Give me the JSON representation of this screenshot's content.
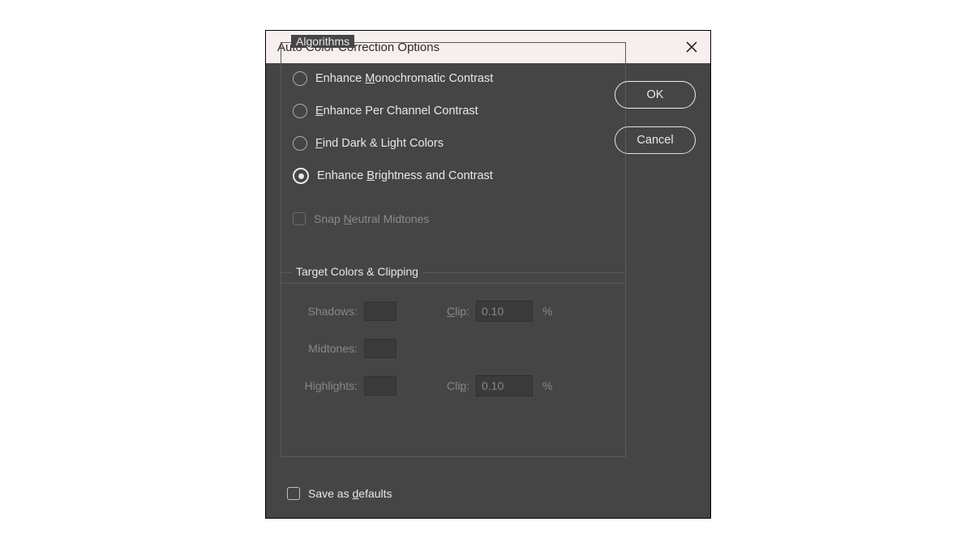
{
  "dialog": {
    "title": "Auto Color Correction Options",
    "close_icon": "close"
  },
  "algorithms": {
    "legend": "Algorithms",
    "options": [
      {
        "label_pre": "Enhance ",
        "mnemonic": "M",
        "label_post": "onochromatic Contrast",
        "selected": false
      },
      {
        "label_pre": "",
        "mnemonic": "E",
        "label_post": "nhance Per Channel Contrast",
        "selected": false
      },
      {
        "label_pre": "",
        "mnemonic": "F",
        "label_post": "ind Dark & Light Colors",
        "selected": false
      },
      {
        "label_pre": "Enhance ",
        "mnemonic": "B",
        "label_post": "rightness and Contrast",
        "selected": true
      }
    ],
    "snap": {
      "pre": "Snap ",
      "mnemonic": "N",
      "post": "eutral Midtones",
      "enabled": false,
      "checked": false
    }
  },
  "targets": {
    "legend": "Target Colors & Clipping",
    "rows": {
      "shadows": {
        "label": "Shadows:",
        "clip_label_pre": "",
        "clip_mnemonic": "C",
        "clip_label_post": "lip:",
        "clip_value": "0.10",
        "pct": "%"
      },
      "midtones": {
        "label": "Midtones:"
      },
      "highlights": {
        "label": "Highlights:",
        "clip_label_pre": "Cli",
        "clip_mnemonic": "p",
        "clip_label_post": ":",
        "clip_value": "0.10",
        "pct": "%"
      }
    },
    "enabled": false
  },
  "save_defaults": {
    "pre": "Save as ",
    "mnemonic": "d",
    "post": "efaults",
    "checked": false
  },
  "buttons": {
    "ok": "OK",
    "cancel": "Cancel"
  }
}
